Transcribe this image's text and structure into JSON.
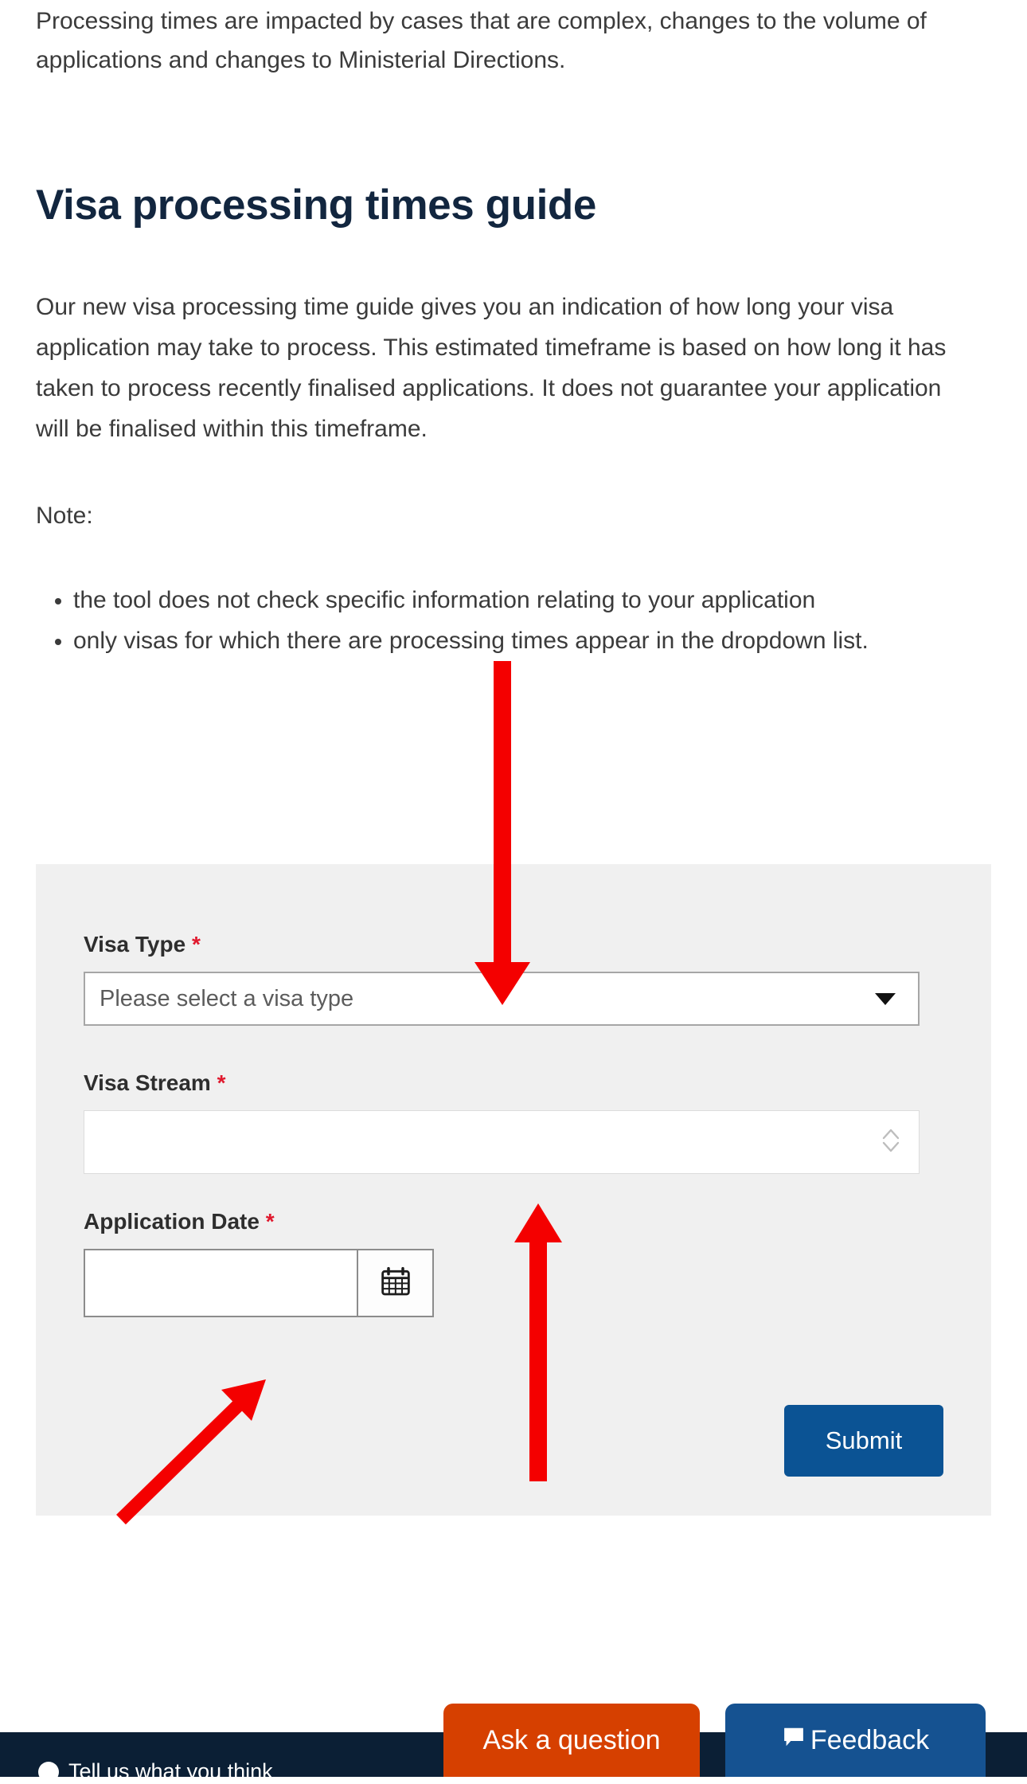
{
  "intro": {
    "clipped_paragraph": "Processing times are impacted by cases that are complex, changes to the volume of applications and changes to Ministerial Directions."
  },
  "heading": "Visa processing times guide",
  "body": {
    "paragraph": "Our new visa processing time guide gives you an indication of how long your visa application may take to process. This estimated timeframe is based on how long it has taken to process recently finalised applications. It does not guarantee your application will be finalised within this timeframe.",
    "note_label": "Note:",
    "note_items": [
      "the tool does not check specific information relating to your application",
      "only visas for which there are processing times appear in the dropdown list."
    ]
  },
  "form": {
    "visa_type": {
      "label": "Visa Type",
      "required_marker": "*",
      "value": "Please select a visa type",
      "caret_icon": "chevron-down-icon"
    },
    "visa_stream": {
      "label": "Visa Stream",
      "required_marker": "*",
      "value": "",
      "stepper_icon": "chevron-up-down-icon"
    },
    "application_date": {
      "label": "Application Date",
      "required_marker": "*",
      "value": "",
      "placeholder": "",
      "calendar_icon": "calendar-icon"
    },
    "submit_label": "Submit"
  },
  "fabs": {
    "ask_label": "Ask a question",
    "feedback_label": "Feedback",
    "feedback_icon": "speech-bubble-icon"
  },
  "footer": {
    "text": "Tell us what you think",
    "icon": "info-circle-icon"
  },
  "colors": {
    "heading": "#12263f",
    "panel": "#f0f0f0",
    "submit": "#0b5394",
    "ask": "#d64000",
    "feedback": "#155291",
    "footer": "#0b1f35",
    "required": "#e0182d",
    "annotation": "#f40000"
  },
  "annotations": {
    "arrow_to_visa_type": "red-down-arrow",
    "arrow_to_visa_stream": "red-up-arrow",
    "arrow_to_application_date": "red-diagonal-arrow"
  }
}
